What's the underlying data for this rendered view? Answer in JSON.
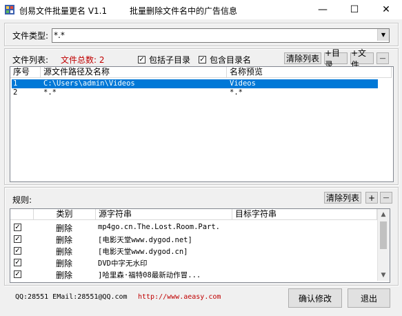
{
  "window": {
    "title": "创易文件批量更名 V1.1",
    "subtitle": "批量删除文件名中的广告信息",
    "minimize": "—",
    "maximize": "☐",
    "close": "✕"
  },
  "file_type": {
    "label": "文件类型:",
    "value": "*.*"
  },
  "file_list": {
    "label": "文件列表:",
    "total": "文件总数: 2",
    "include_subdirs": "包括子目录",
    "include_dirname": "包含目录名",
    "clear_button": "清除列表",
    "add_dir_button": "+目录",
    "add_file_button": "+文件",
    "remove_button": "—",
    "columns": [
      "序号",
      "源文件路径及名称",
      "名称预览"
    ],
    "rows": [
      {
        "index": "1",
        "path": "C:\\Users\\admin\\Videos",
        "preview": "Videos"
      },
      {
        "index": "2",
        "path": "*.*",
        "preview": "*.*"
      }
    ]
  },
  "rules": {
    "label": "规则:",
    "clear_button": "清除列表",
    "add_button": "+",
    "remove_button": "—",
    "columns": [
      "类别",
      "源字符串",
      "目标字符串"
    ],
    "rows": [
      {
        "category": "删除",
        "source": "mp4go.cn.The.Lost.Room.Part.",
        "target": ""
      },
      {
        "category": "删除",
        "source": "[电影天堂www.dygod.net]",
        "target": ""
      },
      {
        "category": "删除",
        "source": "[电影天堂www.dygod.cn]",
        "target": ""
      },
      {
        "category": "删除",
        "source": "DVD中字无水印",
        "target": ""
      },
      {
        "category": "删除",
        "source": "]哈里森·福特08最新动作冒...",
        "target": ""
      }
    ]
  },
  "footer": {
    "contact": "QQ:28551 EMail:28551@QQ.com",
    "website": "http://www.aeasy.com",
    "confirm_button": "确认修改",
    "exit_button": "退出"
  },
  "colors": {
    "accent": "#0078d7",
    "total_text": "#c00000",
    "website_text": "#c00000"
  }
}
